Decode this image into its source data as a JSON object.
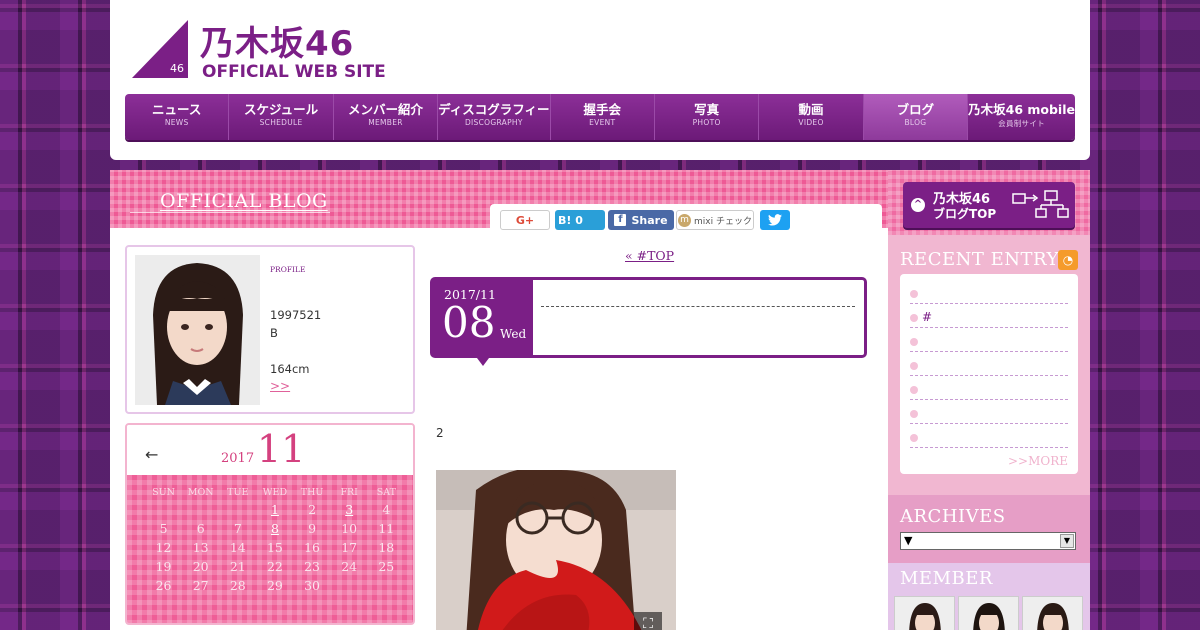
{
  "header": {
    "logo_jp": "乃木坂46",
    "logo_en": "OFFICIAL WEB SITE",
    "logo_badge": "46"
  },
  "nav": [
    {
      "label": "ニュース",
      "sub": "NEWS"
    },
    {
      "label": "スケジュール",
      "sub": "SCHEDULE"
    },
    {
      "label": "メンバー紹介",
      "sub": "MEMBER"
    },
    {
      "label": "ディスコグラフィー",
      "sub": "DISCOGRAPHY"
    },
    {
      "label": "握手会",
      "sub": "EVENT"
    },
    {
      "label": "写真",
      "sub": "PHOTO"
    },
    {
      "label": "動画",
      "sub": "VIDEO"
    },
    {
      "label": "ブログ",
      "sub": "BLOG",
      "active": true
    },
    {
      "label": "乃木坂46 mobile",
      "sub": "会員制サイト"
    }
  ],
  "blog": {
    "title": "OFFICIAL BLOG",
    "top_link": "« #TOP"
  },
  "share": {
    "gplus": "G+",
    "hatena": "B! 0",
    "facebook": "Share",
    "mixi": "mixi チェック",
    "twitter": "twitter"
  },
  "profile": {
    "label": "PROFILE",
    "birthday": "1997521",
    "blood": "B",
    "height": "164cm",
    "more": ">>"
  },
  "calendar": {
    "prev": "←",
    "year": "2017",
    "month": "11",
    "dow": [
      "SUN",
      "MON",
      "TUE",
      "WED",
      "THU",
      "FRI",
      "SAT"
    ],
    "weeks": [
      [
        "",
        "",
        "",
        "1",
        "2",
        "3",
        "4"
      ],
      [
        "5",
        "6",
        "7",
        "8",
        "9",
        "10",
        "11"
      ],
      [
        "12",
        "13",
        "14",
        "15",
        "16",
        "17",
        "18"
      ],
      [
        "19",
        "20",
        "21",
        "22",
        "23",
        "24",
        "25"
      ],
      [
        "26",
        "27",
        "28",
        "29",
        "30",
        "",
        ""
      ]
    ],
    "linked_days": [
      "1",
      "3",
      "8"
    ]
  },
  "post": {
    "year_month": "2017/11",
    "day": "08",
    "weekday": "Wed",
    "body_text": "2"
  },
  "sidebar": {
    "blog_top_line1": "乃木坂46",
    "blog_top_line2": "ブログTOP",
    "recent_title": "RECENT ENTRY",
    "recent_entries": [
      "",
      "#",
      "",
      "",
      "",
      "",
      ""
    ],
    "more": ">>MORE",
    "archives_title": "ARCHIVES",
    "archive_selected": "▼",
    "member_title": "MEMBER"
  },
  "colors": {
    "brand_purple": "#7b1f86",
    "pink": "#ee5a95"
  }
}
